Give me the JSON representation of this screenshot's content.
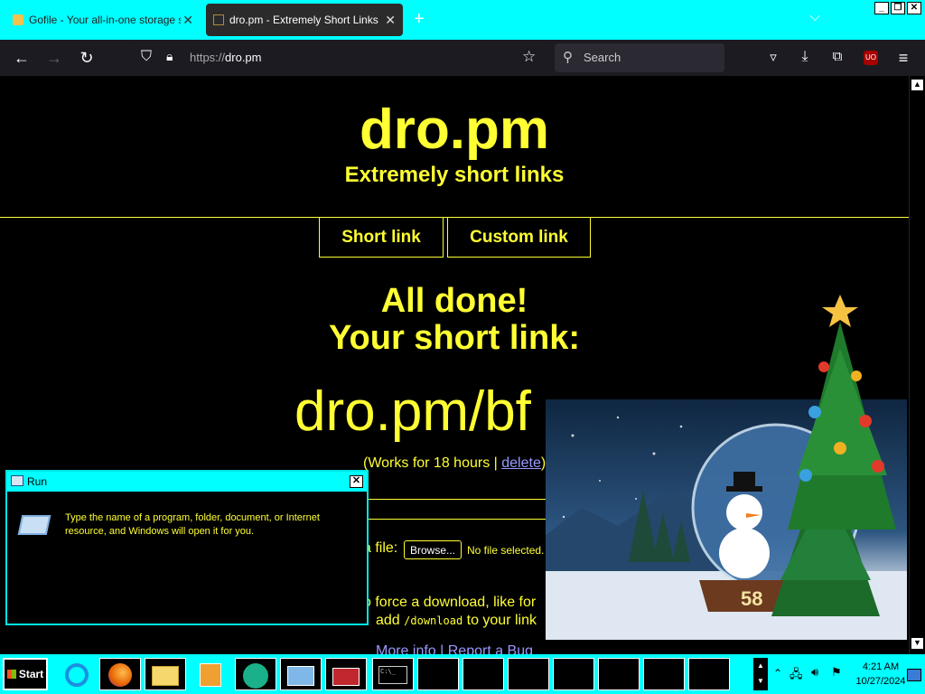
{
  "browser": {
    "tabs": [
      {
        "label": "Gofile - Your all-in-one storage solu",
        "active": false
      },
      {
        "label": "dro.pm - Extremely Short Links",
        "active": true
      }
    ],
    "url_prefix": "https://",
    "url_host": "dro.pm",
    "search_placeholder": "Search",
    "window_buttons": [
      "_",
      "❐",
      "✕"
    ]
  },
  "page": {
    "title": "dro.pm",
    "subtitle": "Extremely short links",
    "nav": [
      "Short link",
      "Custom link"
    ],
    "done_line1": "All done!",
    "done_line2": "Your short link:",
    "short_link": "dro.pm/bf",
    "works_prefix": "(Works for 18 hours | ",
    "delete_label": "delete",
    "works_suffix": ")",
    "upload_label": "a file:",
    "browse_label": "Browse...",
    "no_file": "No file selected.",
    "force_line1": "o force a download, like for",
    "force_line2_prefix": "add ",
    "force_code": "/download",
    "force_line2_suffix": " to your link",
    "footer_links": "More info | Report a Bug"
  },
  "run_dialog": {
    "title": "Run",
    "message": "Type the name of a program, folder, document, or Internet resource, and Windows will open it for you."
  },
  "taskbar": {
    "start_label": "Start",
    "time": "4:21 AM",
    "date": "10/27/2024"
  },
  "widget": {
    "counter": "58"
  },
  "colors": {
    "accent": "#00ffff",
    "page_text": "#ffff33",
    "link": "#9999ff"
  }
}
